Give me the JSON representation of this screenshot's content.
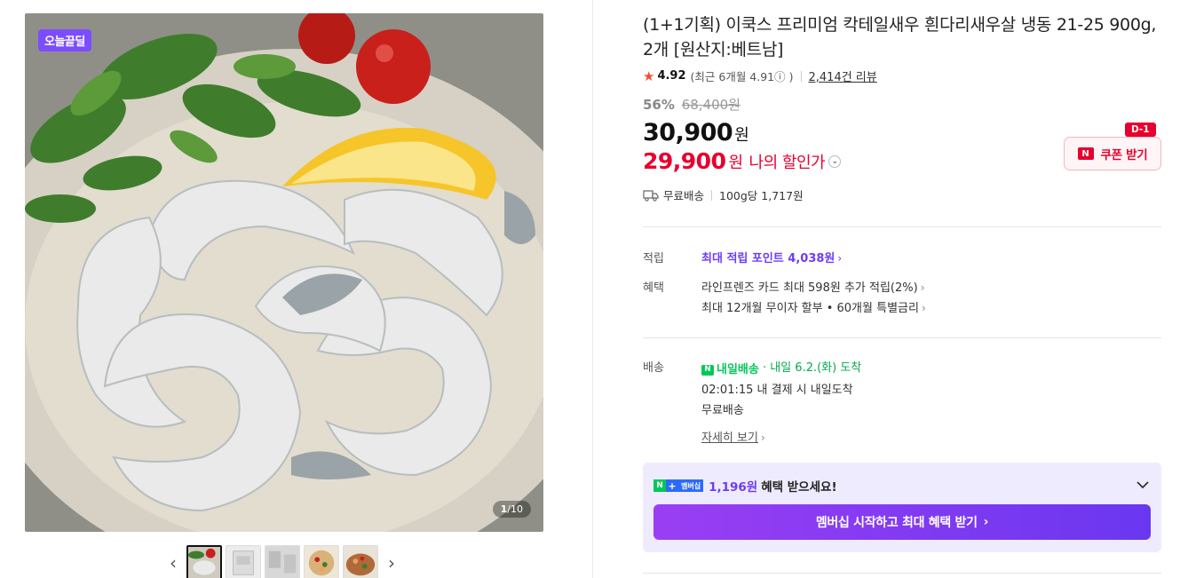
{
  "gallery": {
    "badge": "오늘끝딜",
    "counter_current": "1",
    "counter_total": "/10",
    "thumb_count": 5
  },
  "product": {
    "title": "(1+1기획) 이쿡스 프리미엄 칵테일새우 흰다리새우살 냉동 21-25 900g, 2개 [원산지:베트남]",
    "rating": "4.92",
    "recent_rating": "(최근 6개월 4.91ⓘ )",
    "reviews": "2,414건 리뷰",
    "discount_pct": "56%",
    "original_price": "68,400원",
    "price": "30,900",
    "price_unit": "원",
    "my_price": "29,900",
    "my_price_unit": "원",
    "my_price_label": "나의 할인가",
    "coupon_label": "쿠폰 받기",
    "coupon_tag": "D-1",
    "shipping": "무료배송",
    "unit_price": "100g당 1,717원"
  },
  "benefits": {
    "points_key": "적립",
    "points_text": "최대 적립 포인트 4,038원",
    "benefit_key": "혜택",
    "benefit_line1": "라인프렌즈 카드 최대 598원 추가 적립(2%)",
    "benefit_line2": "최대 12개월 무이자 할부 • 60개월 특별금리"
  },
  "delivery": {
    "key": "배송",
    "badge": "내일배송",
    "arrival": "· 내일 6.2.(화) 도착",
    "deadline": "02:01:15  내 결제 시 내일도착",
    "fee": "무료배송",
    "more": "자세히 보기"
  },
  "membership": {
    "tag": "멤버십",
    "amount": "1,196원",
    "text": "혜택 받으세요!",
    "button": "멤버십 시작하고 최대 혜택 받기"
  },
  "colors": {
    "accent_red": "#e7002f",
    "accent_purple": "#6d3df5",
    "naver_green": "#03c75a"
  }
}
